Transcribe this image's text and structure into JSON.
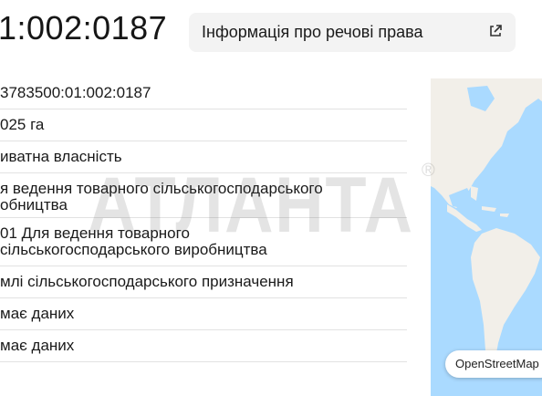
{
  "header": {
    "cadastral_number": "1:002:0187",
    "rights_button_label": "Інформація про речові права"
  },
  "details": [
    "3783500:01:002:0187",
    "025 га",
    "иватна власність",
    "я ведення товарного сільськогосподарського",
    "обництва",
    "01 Для ведення товарного",
    "сільськогосподарського виробництва",
    "млі сільськогосподарського призначення",
    "має даних",
    "має даних"
  ],
  "map": {
    "attribution": "OpenStreetMap",
    "land_color": "#f2efe9",
    "water_color": "#aadaff"
  },
  "watermark": {
    "text": "АТЛАНТА",
    "symbol": "®"
  }
}
